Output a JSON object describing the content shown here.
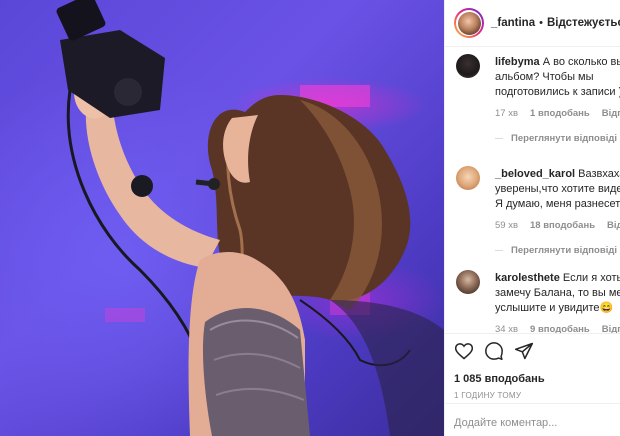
{
  "post": {
    "username": "_fantina",
    "separator": "•",
    "follow_label": "Відстежується"
  },
  "comments": [
    {
      "username": "lifebyma",
      "line1": "А во сколько вый",
      "line2": "альбом? Чтобы мы",
      "line3": "подготовились к записи )))",
      "time": "17 хв",
      "likes": "1 вподобань",
      "reply": "Відпові",
      "view_replies": "Переглянути відповіді"
    },
    {
      "username": "_beloved_karol",
      "line1": "Вазвхахаавх",
      "line2": "уверены,что хотите видеть",
      "line3": "Я думаю, меня разнесет😳",
      "time": "59 хв",
      "likes": "18 вподобань",
      "reply": "Відпові",
      "view_replies": "Переглянути відповіді"
    },
    {
      "username": "karolesthete",
      "line1": "Если я хоть гд",
      "line2": "замечу Балана, то вы меня",
      "line3": "услышите и увидите😄",
      "time": "34 хв",
      "likes": "9 вподобань",
      "reply": "Відпові"
    }
  ],
  "actions": {
    "likes_count": "1 085 вподобань",
    "posted_time": "1 ГОДИНУ ТОМУ"
  },
  "composer": {
    "placeholder": "Додайте коментар..."
  }
}
